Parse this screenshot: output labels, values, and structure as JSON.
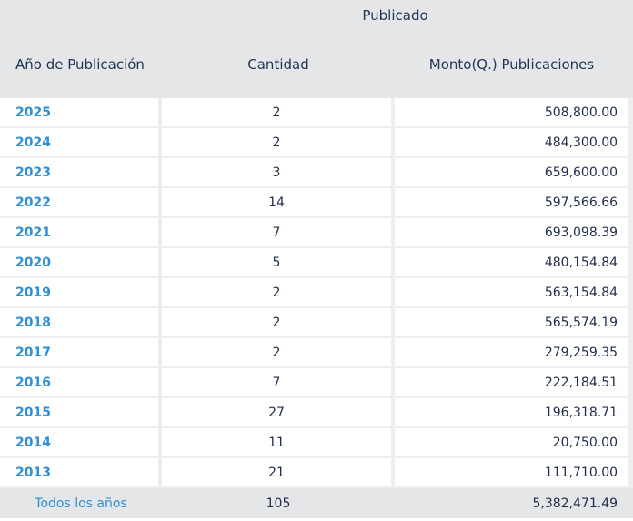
{
  "header": {
    "group_label": "Publicado",
    "col_year": "Año de Publicación",
    "col_quantity": "Cantidad",
    "col_amount": "Monto(Q.) Publicaciones"
  },
  "rows": [
    {
      "year": "2025",
      "quantity": "2",
      "amount": "508,800.00"
    },
    {
      "year": "2024",
      "quantity": "2",
      "amount": "484,300.00"
    },
    {
      "year": "2023",
      "quantity": "3",
      "amount": "659,600.00"
    },
    {
      "year": "2022",
      "quantity": "14",
      "amount": "597,566.66"
    },
    {
      "year": "2021",
      "quantity": "7",
      "amount": "693,098.39"
    },
    {
      "year": "2020",
      "quantity": "5",
      "amount": "480,154.84"
    },
    {
      "year": "2019",
      "quantity": "2",
      "amount": "563,154.84"
    },
    {
      "year": "2018",
      "quantity": "2",
      "amount": "565,574.19"
    },
    {
      "year": "2017",
      "quantity": "2",
      "amount": "279,259.35"
    },
    {
      "year": "2016",
      "quantity": "7",
      "amount": "222,184.51"
    },
    {
      "year": "2015",
      "quantity": "27",
      "amount": "196,318.71"
    },
    {
      "year": "2014",
      "quantity": "11",
      "amount": "20,750.00"
    },
    {
      "year": "2013",
      "quantity": "21",
      "amount": "111,710.00"
    }
  ],
  "totals": {
    "label": "Todos los años",
    "quantity": "105",
    "amount": "5,382,471.49"
  },
  "colors": {
    "link": "#2f8fd6",
    "header_bg": "#e5e6e8",
    "text": "#1f2d4a"
  }
}
